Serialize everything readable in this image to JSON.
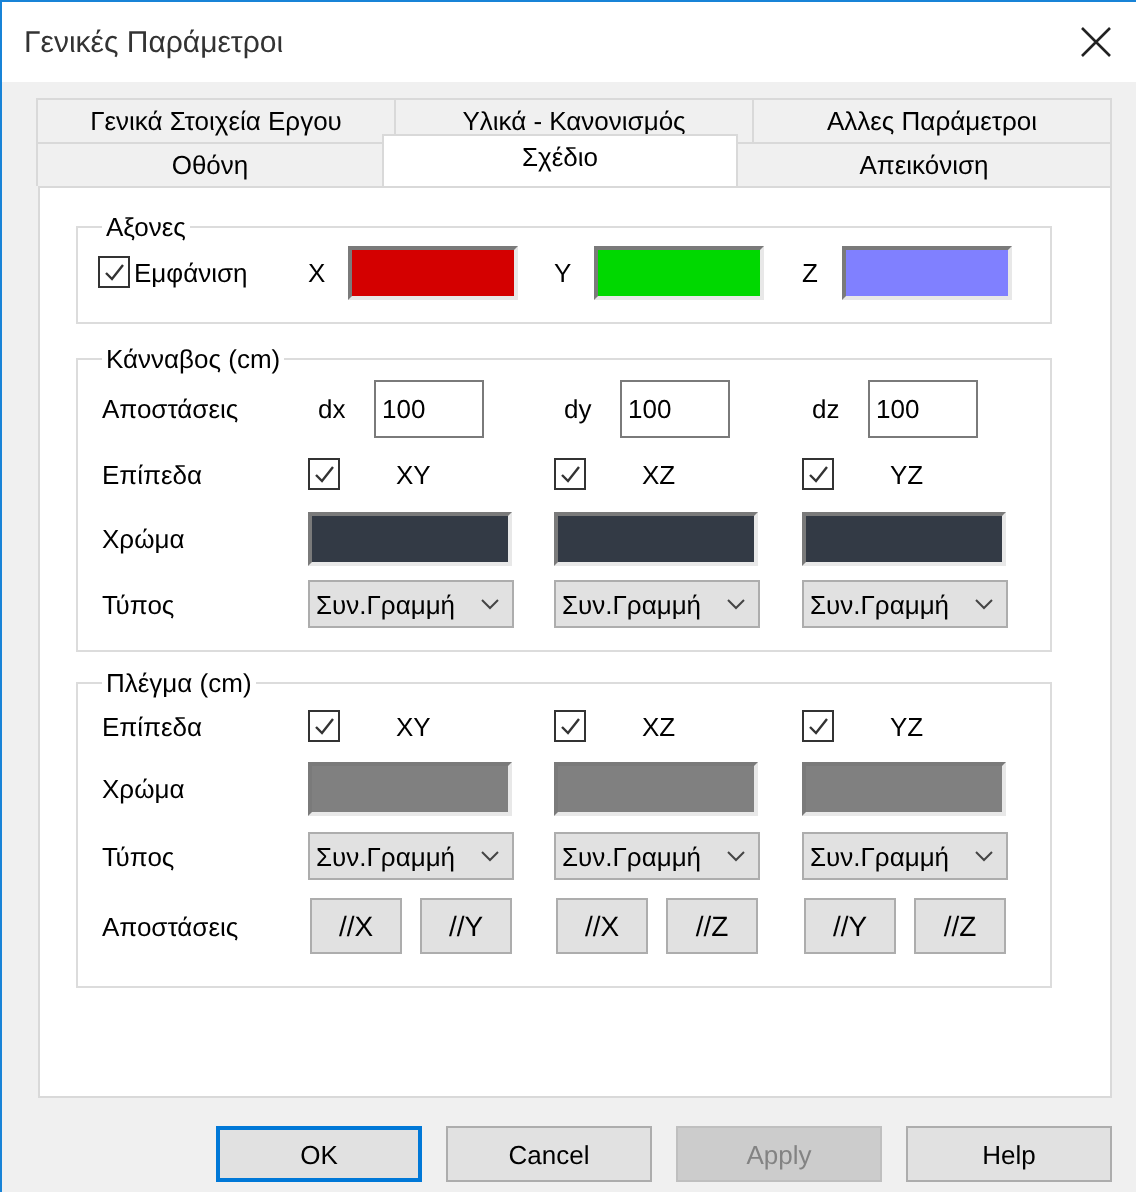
{
  "window": {
    "title": "Γενικές Παράμετροι"
  },
  "tab_rows": [
    [
      {
        "label": "Γενικά Στοιχεία Εργου",
        "selected": false
      },
      {
        "label": "Υλικά - Κανονισμός",
        "selected": false
      },
      {
        "label": "Αλλες Παράμετροι",
        "selected": false
      }
    ],
    [
      {
        "label": "Οθόνη",
        "selected": false
      },
      {
        "label": "Σχέδιο",
        "selected": true
      },
      {
        "label": "Απεικόνιση",
        "selected": false
      }
    ]
  ],
  "axes": {
    "title": "Αξονες",
    "show": {
      "label": "Εμφάνιση",
      "checked": true
    },
    "colors": [
      {
        "label": "X",
        "color": "#d40000"
      },
      {
        "label": "Y",
        "color": "#00d800"
      },
      {
        "label": "Z",
        "color": "#8080ff"
      }
    ]
  },
  "grid": {
    "title": "Κάνναβος (cm)",
    "distances": {
      "label": "Αποστάσεις",
      "fields": [
        {
          "label": "dx",
          "value": "100"
        },
        {
          "label": "dy",
          "value": "100"
        },
        {
          "label": "dz",
          "value": "100"
        }
      ]
    },
    "planes": {
      "label": "Επίπεδα",
      "items": [
        {
          "label": "XY",
          "checked": true
        },
        {
          "label": "XZ",
          "checked": true
        },
        {
          "label": "YZ",
          "checked": true
        }
      ]
    },
    "color": {
      "label": "Χρώμα",
      "swatches": [
        {
          "color": "#333a45"
        },
        {
          "color": "#333a45"
        },
        {
          "color": "#333a45"
        }
      ]
    },
    "type": {
      "label": "Τύπος",
      "selects": [
        "Συν.Γραμμή",
        "Συν.Γραμμή",
        "Συν.Γραμμή"
      ]
    }
  },
  "mesh": {
    "title": "Πλέγμα (cm)",
    "planes": {
      "label": "Επίπεδα",
      "items": [
        {
          "label": "XY",
          "checked": true
        },
        {
          "label": "XZ",
          "checked": true
        },
        {
          "label": "YZ",
          "checked": true
        }
      ]
    },
    "color": {
      "label": "Χρώμα",
      "swatches": [
        {
          "color": "#808080"
        },
        {
          "color": "#808080"
        },
        {
          "color": "#808080"
        }
      ]
    },
    "type": {
      "label": "Τύπος",
      "selects": [
        "Συν.Γραμμή",
        "Συν.Γραμμή",
        "Συν.Γραμμή"
      ]
    },
    "distances": {
      "label": "Αποστάσεις",
      "buttons": [
        [
          "//X",
          "//Y"
        ],
        [
          "//X",
          "//Z"
        ],
        [
          "//Y",
          "//Z"
        ]
      ]
    }
  },
  "buttons": [
    {
      "label": "OK",
      "default": true,
      "disabled": false
    },
    {
      "label": "Cancel",
      "default": false,
      "disabled": false
    },
    {
      "label": "Apply",
      "default": false,
      "disabled": true
    },
    {
      "label": "Help",
      "default": false,
      "disabled": false
    }
  ]
}
